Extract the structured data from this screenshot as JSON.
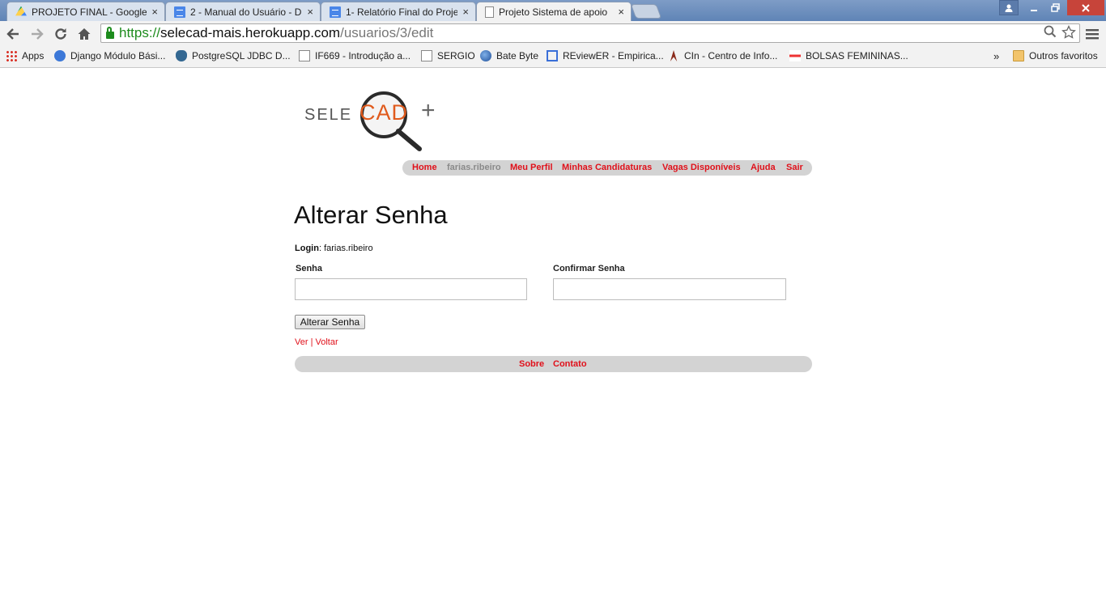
{
  "browser": {
    "tabs": [
      {
        "title": "PROJETO FINAL - Google",
        "icon": "google-drive-icon",
        "active": false
      },
      {
        "title": "2 - Manual do Usuário - D",
        "icon": "google-docs-icon",
        "active": false
      },
      {
        "title": "1- Relatório Final do Proje",
        "icon": "google-docs-icon",
        "active": false
      },
      {
        "title": "Projeto Sistema de apoio",
        "icon": "page-icon",
        "active": true
      }
    ],
    "tab_close": "×",
    "url": {
      "scheme": "https://",
      "host": "selecad-mais.herokuapp.com",
      "path": "/usuarios/3/edit"
    },
    "bookmarks": [
      {
        "label": "Apps",
        "icon": "apps-grid-icon"
      },
      {
        "label": "Django Módulo Bási...",
        "icon": "django-icon"
      },
      {
        "label": "PostgreSQL JDBC D...",
        "icon": "postgresql-icon"
      },
      {
        "label": "IF669 - Introdução a...",
        "icon": "page-icon"
      },
      {
        "label": "SERGIO",
        "icon": "page-icon"
      },
      {
        "label": "Bate Byte",
        "icon": "globe-icon"
      },
      {
        "label": "REviewER - Empirica...",
        "icon": "reviewer-icon"
      },
      {
        "label": "CIn - Centro de Info...",
        "icon": "cin-icon"
      },
      {
        "label": "BOLSAS FEMININAS...",
        "icon": "bolsas-icon"
      }
    ],
    "bookmarks_overflow": "»",
    "other_bookmarks": "Outros favoritos"
  },
  "site": {
    "logo": {
      "left_text": "SELE",
      "center_text": "CAD",
      "plus": "+"
    },
    "nav": {
      "home": "Home",
      "user": "farias.ribeiro",
      "profile": "Meu Perfil",
      "applications": "Minhas Candidaturas",
      "vacancies": "Vagas Disponíveis",
      "help": "Ajuda",
      "logout": "Sair"
    },
    "title": "Alterar Senha",
    "login_label": "Login",
    "login_value": "farias.ribeiro",
    "form": {
      "password_label": "Senha",
      "password_value": "",
      "confirm_label": "Confirmar Senha",
      "confirm_value": "",
      "submit": "Alterar Senha"
    },
    "links": {
      "view": "Ver",
      "separator": "|",
      "back": "Voltar"
    },
    "footer": {
      "about": "Sobre",
      "contact": "Contato"
    }
  },
  "colors": {
    "link_red": "#e0101a",
    "nav_bar_bg": "#d3d3d3",
    "logo_orange": "#e05a1c"
  }
}
